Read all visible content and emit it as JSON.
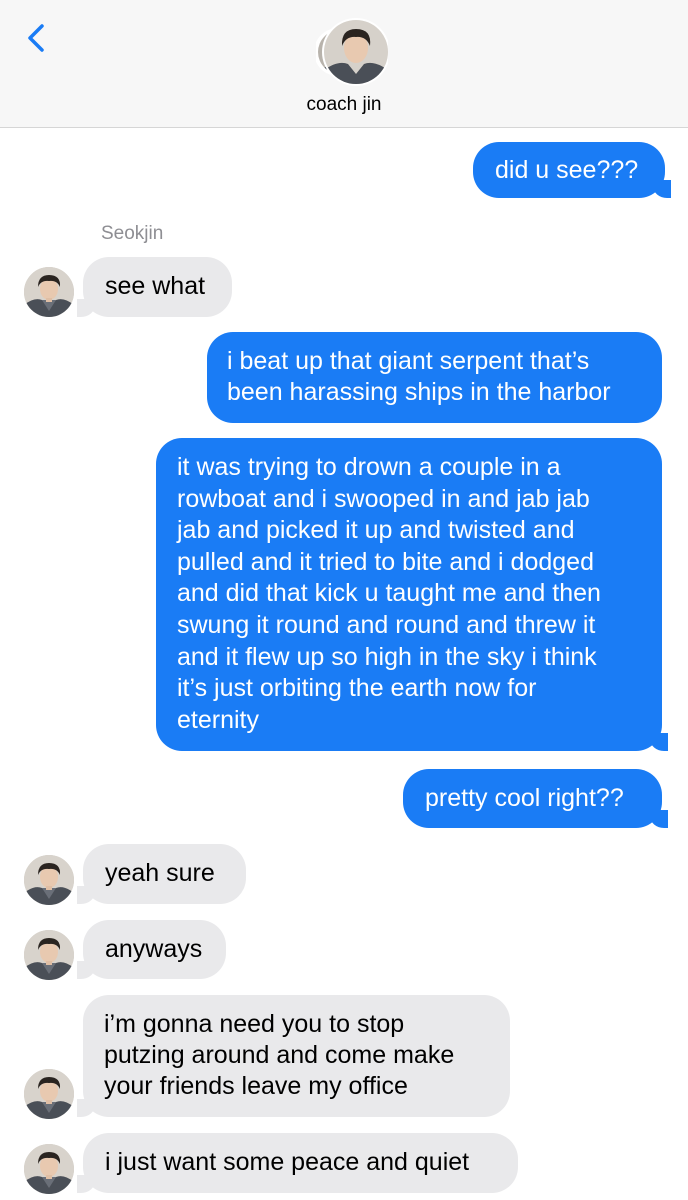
{
  "header": {
    "contact_name": "coach jin",
    "back_icon": "chevron-left-icon",
    "accent_color": "#1a7cf5"
  },
  "thread": {
    "sender_label": "Seokjin",
    "messages": [
      {
        "direction": "outgoing",
        "text": "did u see???"
      },
      {
        "direction": "incoming",
        "text": "see what"
      },
      {
        "direction": "outgoing",
        "lines": [
          "i beat up that giant serpent that’s",
          "been harassing ships in the harbor"
        ]
      },
      {
        "direction": "outgoing",
        "lines": [
          "it was trying to drown a couple in a",
          "rowboat and i swooped in and jab jab",
          "jab and picked it up and twisted and",
          "pulled and it tried to bite and i dodged",
          "and did that kick u taught me and then",
          "swung it round and round and threw it",
          "and it flew up so high in the sky i think",
          "it’s just orbiting the earth now for",
          "eternity"
        ]
      },
      {
        "direction": "outgoing",
        "text": "pretty cool right??"
      },
      {
        "direction": "incoming",
        "text": "yeah sure"
      },
      {
        "direction": "incoming",
        "text": "anyways"
      },
      {
        "direction": "incoming",
        "lines": [
          "i’m gonna need you to stop",
          "putzing around and come make",
          "your friends leave my office"
        ]
      },
      {
        "direction": "incoming",
        "text": "i just want some peace and quiet"
      }
    ]
  },
  "colors": {
    "outgoing_bubble": "#1a7cf5",
    "incoming_bubble": "#e9e9eb",
    "header_bg": "#f7f7f7"
  }
}
